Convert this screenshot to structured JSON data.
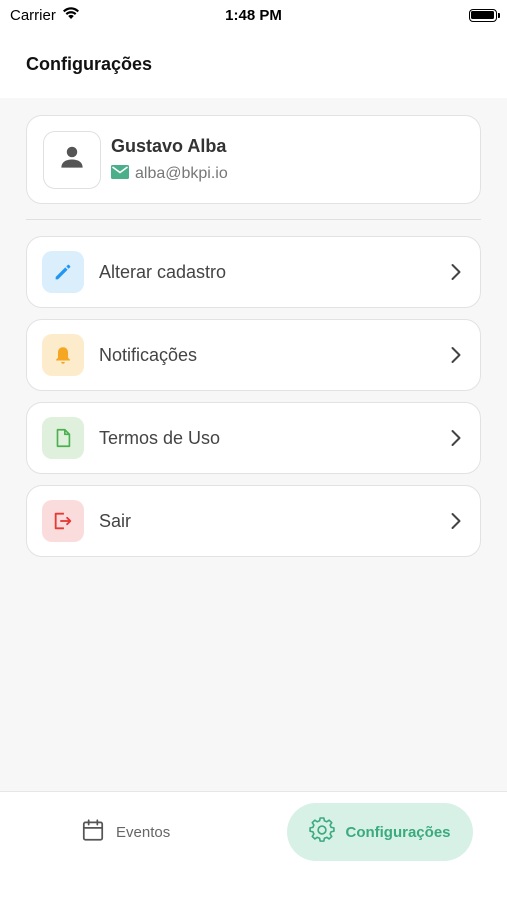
{
  "status_bar": {
    "carrier": "Carrier",
    "time": "1:48 PM",
    "wifi_icon": "wifi-icon",
    "battery_icon": "battery-icon"
  },
  "header": {
    "title": "Configurações"
  },
  "profile": {
    "name": "Gustavo Alba",
    "email": "alba@bkpi.io",
    "avatar_icon": "person-icon",
    "email_icon": "mail-icon",
    "email_icon_color": "#4caf8c"
  },
  "menu": {
    "items": [
      {
        "label": "Alterar cadastro",
        "icon": "pencil-icon",
        "icon_color": "#2196f3",
        "icon_bg": "#dbeefc"
      },
      {
        "label": "Notificações",
        "icon": "bell-icon",
        "icon_color": "#f5a623",
        "icon_bg": "#fdeccc"
      },
      {
        "label": "Termos de Uso",
        "icon": "document-icon",
        "icon_color": "#4caf50",
        "icon_bg": "#dff0dc"
      },
      {
        "label": "Sair",
        "icon": "logout-icon",
        "icon_color": "#e53935",
        "icon_bg": "#fbdcdc"
      }
    ]
  },
  "tab_bar": {
    "tabs": [
      {
        "label": "Eventos",
        "icon": "calendar-icon",
        "active": false
      },
      {
        "label": "Configurações",
        "icon": "gear-icon",
        "active": true
      }
    ],
    "active_color": "#3aaa7f",
    "active_bg": "#d8f1e6"
  }
}
